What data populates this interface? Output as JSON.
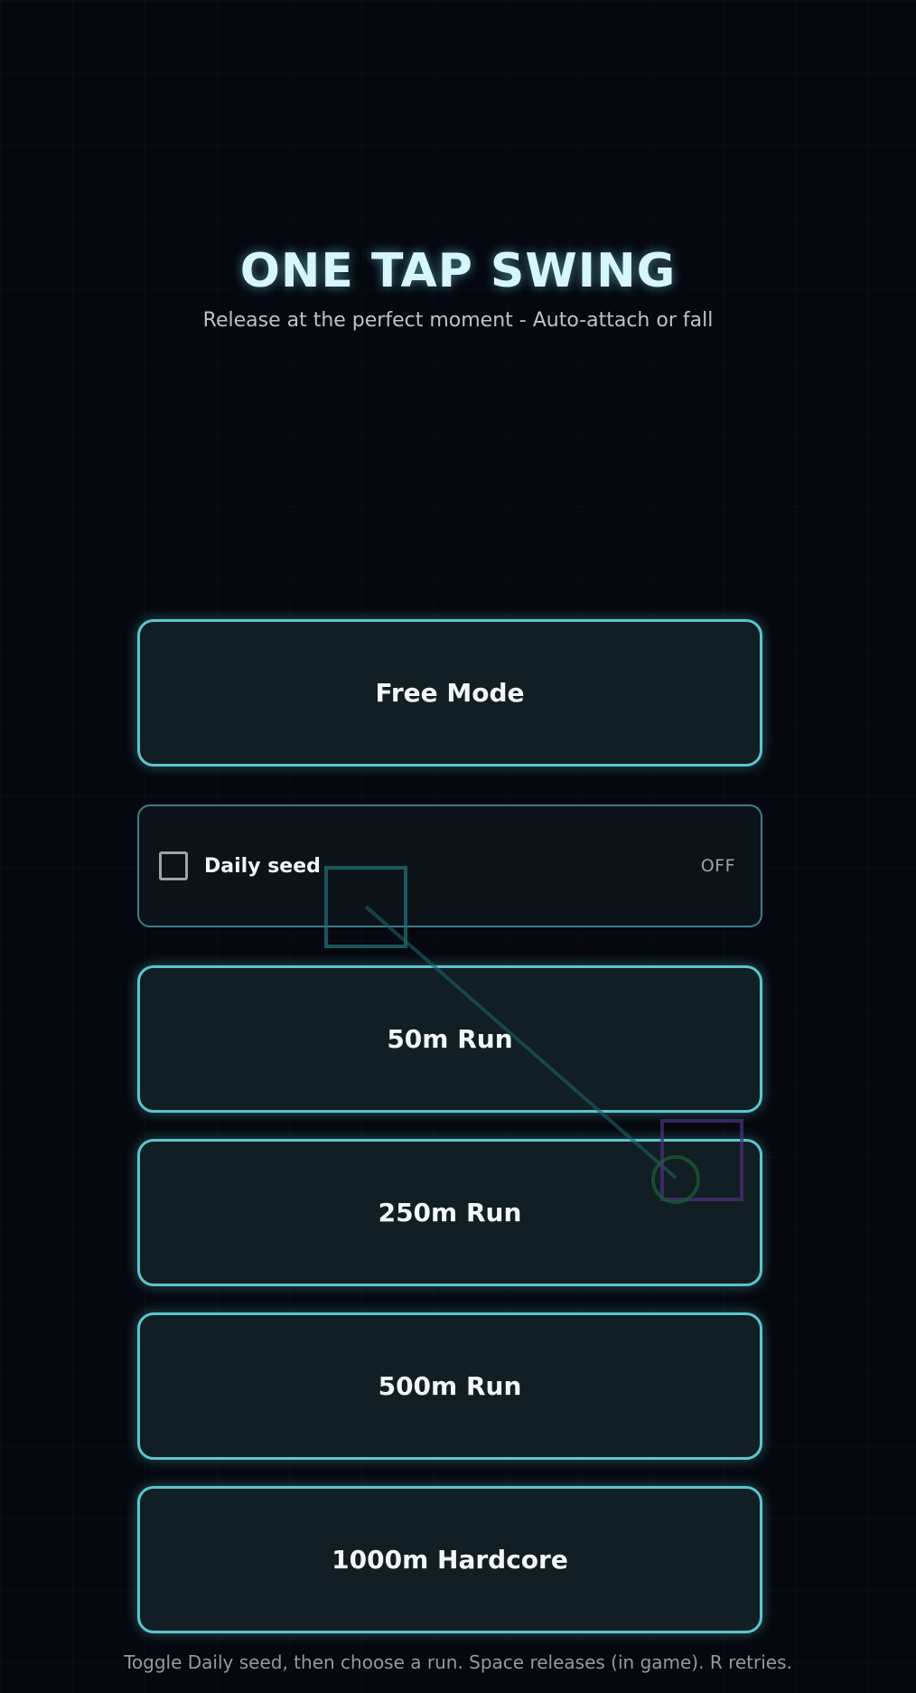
{
  "header": {
    "title": "ONE TAP SWING",
    "subtitle": "Release at the perfect moment - Auto-attach or fall"
  },
  "menu": {
    "free_mode": "Free Mode",
    "daily_seed": {
      "label": "Daily seed",
      "state": "OFF",
      "checked": false
    },
    "run_50": "50m Run",
    "run_250": "250m Run",
    "run_500": "500m Run",
    "run_1000": "1000m Hardcore"
  },
  "footer": {
    "hint": "Toggle Daily seed, then choose a run. Space releases (in game). R retries."
  },
  "colors": {
    "background": "#05080f",
    "accent": "#5cc5cf",
    "button_fill": "#111e23",
    "title_glow": "#d6f6fb",
    "anchor_block": "#1f6f74",
    "target_block": "#4a2f78",
    "player": "#1f5a3a"
  }
}
